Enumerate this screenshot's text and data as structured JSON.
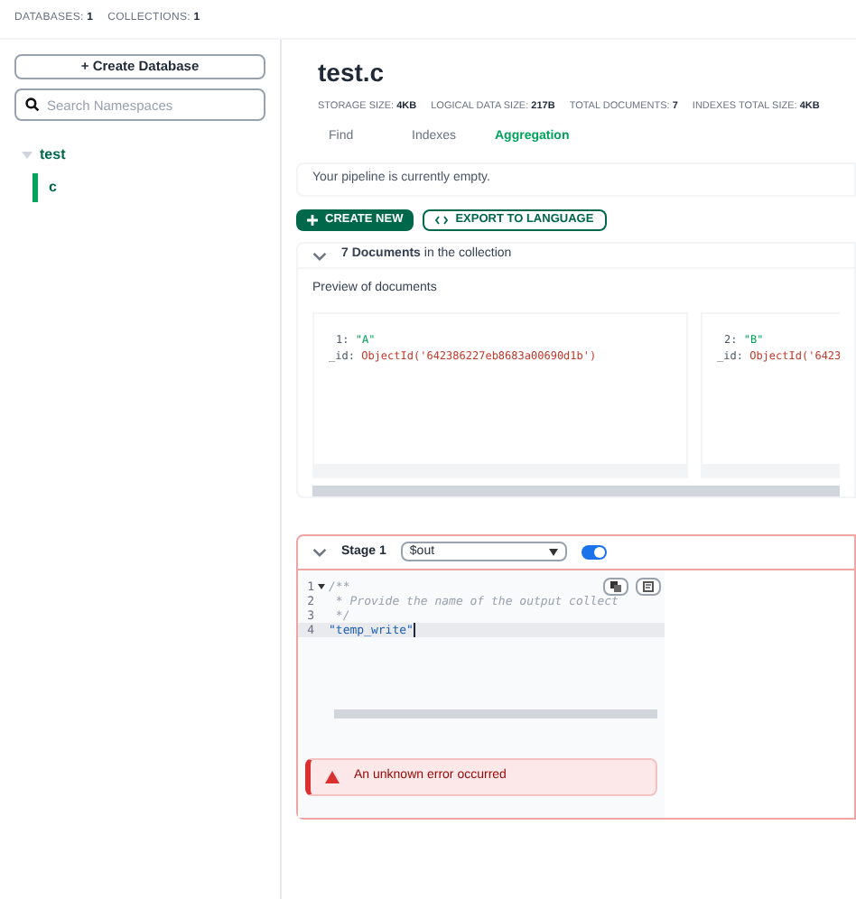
{
  "top_bar": [
    {
      "label": "DATABASES:",
      "value": "1"
    },
    {
      "label": "COLLECTIONS:",
      "value": "1"
    }
  ],
  "sidebar": {
    "create_button": "+ Create Database",
    "search": {
      "placeholder": "Search Namespaces"
    },
    "tree": [
      {
        "label": "test",
        "expanded": true,
        "children": [
          {
            "label": "c",
            "selected": true
          }
        ]
      }
    ]
  },
  "collection": {
    "title": "test.c",
    "stats": [
      {
        "label": "STORAGE SIZE:",
        "value": "4KB"
      },
      {
        "label": "LOGICAL DATA SIZE:",
        "value": "217B"
      },
      {
        "label": "TOTAL DOCUMENTS:",
        "value": "7"
      },
      {
        "label": "INDEXES TOTAL SIZE:",
        "value": "4KB"
      }
    ],
    "tabs": [
      {
        "label": "Find",
        "selected": false
      },
      {
        "label": "Indexes",
        "selected": false
      },
      {
        "label": "Aggregation",
        "selected": true
      }
    ]
  },
  "pipeline_status": "Your pipeline is currently empty.",
  "actions": {
    "create_new": "CREATE NEW",
    "export": "EXPORT TO LANGUAGE"
  },
  "documents_panel": {
    "expanded": true,
    "count": "7 Documents",
    "suffix": "in the collection",
    "preview_label": "Preview of documents",
    "documents": [
      {
        "key": "1:",
        "value": "\"A\"",
        "id_key": "_id:",
        "id": "ObjectId('642386227eb8683a00690d1b')"
      },
      {
        "key": "2:",
        "value": "\"B\"",
        "id_key": "_id:",
        "id": "ObjectId('6423"
      }
    ]
  },
  "stage": {
    "title": "Stage 1",
    "operator": "$out",
    "enabled": true,
    "expanded": true,
    "code": [
      {
        "number": "1",
        "text": "/**",
        "foldable": true,
        "active": false
      },
      {
        "number": "2",
        "text": " * Provide the name of the output collect",
        "foldable": false,
        "active": false
      },
      {
        "number": "3",
        "text": " */",
        "foldable": false,
        "active": false
      },
      {
        "number": "4",
        "text": "\"temp_write\"",
        "foldable": false,
        "active": true
      }
    ],
    "error": "An unknown error occurred"
  }
}
